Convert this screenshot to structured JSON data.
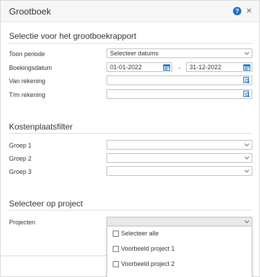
{
  "dialog": {
    "title": "Grootboek",
    "help_icon": "help-icon",
    "close_icon": "close-icon",
    "help_glyph": "?",
    "close_glyph": "×"
  },
  "selection": {
    "title": "Selectie voor het grootboekrapport",
    "period_label": "Toon periode",
    "period_value": "Selecteer datums",
    "date_label": "Boekingsdatum",
    "date_from": "01-01-2022",
    "date_separator": "-",
    "date_to": "31-12-2022",
    "from_account_label": "Van rekening",
    "from_account_value": "",
    "to_account_label": "T/m rekening",
    "to_account_value": ""
  },
  "cost_center": {
    "title": "Kostenplaatsfilter",
    "group1_label": "Groep 1",
    "group2_label": "Groep 2",
    "group3_label": "Groep 3",
    "group1_value": "",
    "group2_value": "",
    "group3_value": ""
  },
  "project": {
    "title": "Selecteer op project",
    "projects_label": "Projecten",
    "projects_value": "",
    "options": [
      {
        "label": "Selecteer alle",
        "checked": false
      },
      {
        "label": "Voorbeeld project 1",
        "checked": false
      },
      {
        "label": "Voorbeeld project 2",
        "checked": false
      }
    ]
  },
  "colors": {
    "accent": "#1a6fc4",
    "header_bg": "#f6f6f6",
    "border": "#bfbfbf"
  }
}
